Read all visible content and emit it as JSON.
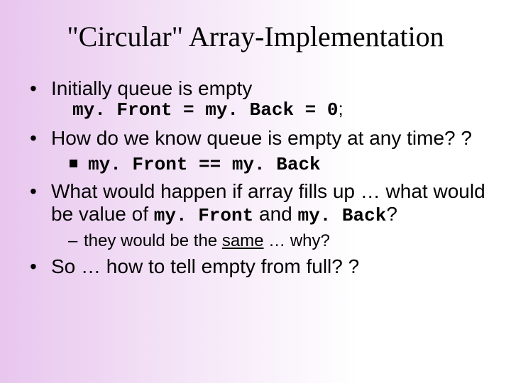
{
  "title": "\"Circular\" Array-Implementation",
  "bullets": {
    "b1": "Initially queue is empty",
    "b1_code": "my. Front = my. Back = 0",
    "b1_code_suffix": ";",
    "b2": "How do we know queue is empty at any time? ?",
    "b2_sub": "my. Front == my. Back",
    "b3_pre": "What would happen if array fills up … what would be value of ",
    "b3_code1": "my. Front",
    "b3_mid": " and ",
    "b3_code2": "my. Back",
    "b3_post": "?",
    "b3_sub_pre": "they would be the ",
    "b3_sub_underline": "same",
    "b3_sub_post": "  …  why?",
    "b4": "So … how to tell empty from full? ?"
  }
}
